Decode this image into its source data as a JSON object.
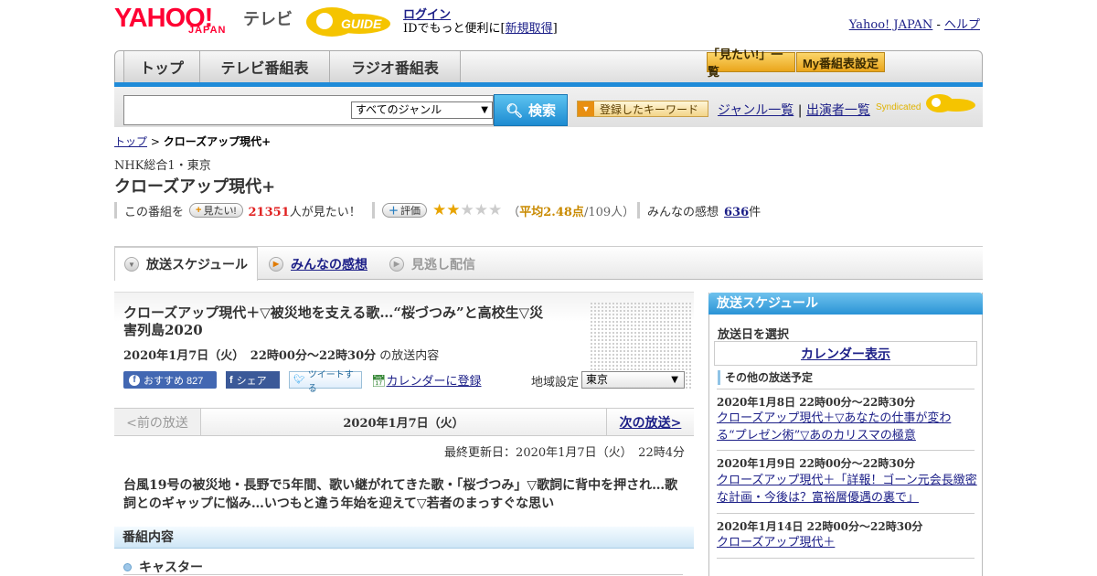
{
  "header": {
    "logo_yahoo": "YAHOO!",
    "logo_japan": "JAPAN",
    "logo_tv": "テレビ",
    "logo_gguide": "G-GUIDE",
    "login": "ログイン",
    "login_sub_prefix": "IDでもっと便利に[",
    "login_sub_link": "新規取得",
    "login_sub_suffix": "]",
    "yahoo_japan_link": "Yahoo! JAPAN",
    "sep": " - ",
    "help_link": "ヘルプ"
  },
  "nav": {
    "tabs": [
      "トップ",
      "テレビ番組表",
      "ラジオ番組表"
    ],
    "mitai_list": "「見たい!」一覧",
    "my_schedule": "My番組表設定"
  },
  "search": {
    "genre_value": "すべてのジャンル",
    "search_button": "検索",
    "keyword_button": "登録したキーワード",
    "genre_list": "ジャンル一覧",
    "divider": "|",
    "cast_list": "出演者一覧",
    "syndicated": "Syndicated"
  },
  "breadcrumb": {
    "top": "トップ",
    "sep": ">",
    "current": "クローズアップ現代+"
  },
  "program": {
    "station": "NHK総合1・東京",
    "title": "クローズアップ現代+",
    "mitai_prefix": "この番組を",
    "mitai_button": "見たい!",
    "mitai_count": "21351",
    "mitai_suffix": "人が見たい！",
    "rating_button": "評価",
    "rating_value": 2,
    "rating_max": 5,
    "rating_avg_prefix": "（",
    "rating_avg": "平均2.48点",
    "rating_people": "/109人）",
    "impressions_prefix": "みんなの感想",
    "impressions_count": "636",
    "impressions_suffix": "件"
  },
  "tabs": {
    "schedule": "放送スケジュール",
    "impressions": "みんなの感想",
    "missed": "見逃し配信"
  },
  "episode": {
    "title": "クローズアップ現代＋▽被災地を支える歌…“桜づつみ”と高校生▽災害列島2020",
    "date": "2020年1月7日（火）　22時00分～22時30分",
    "date_suffix": "の放送内容",
    "fb_recommend": "おすすめ 827",
    "fb_share": "シェア",
    "tweet": "ツイートする",
    "calendar_register": "カレンダーに登録",
    "region_label": "地域設定",
    "region_value": "東京",
    "prev": "<前の放送",
    "current_date": "2020年1月7日（火）",
    "next": "次の放送>",
    "updated": "最終更新日：2020年1月7日（火）　22時4分",
    "description": "台風19号の被災地・長野で5年間、歌い継がれてきた歌・「桜づつみ」▽歌詞に背中を押され…歌詞とのギャップに悩み…いつもと違う年始を迎えて▽若者のまっすぐな思い",
    "section_head": "番組内容",
    "caster": "キャスター"
  },
  "sidebar": {
    "head": "放送スケジュール",
    "pick_day": "放送日を選択",
    "calendar": "カレンダー表示",
    "other_head": "その他の放送予定",
    "items": [
      {
        "date": "2020年1月8日  22時00分～22時30分",
        "title": "クローズアップ現代＋▽あなたの仕事が変わる“プレゼン術”▽あのカリスマの極意"
      },
      {
        "date": "2020年1月9日  22時00分～22時30分",
        "title": "クローズアップ現代＋「詳報！ゴーン元会長緻密な計画・今後は？富裕層優遇の裏で」"
      },
      {
        "date": "2020年1月14日  22時00分～22時30分",
        "title": "クローズアップ現代＋"
      }
    ]
  },
  "colors": {
    "accent_blue": "#1f8bd8",
    "brand_red": "#ff0033",
    "rating_orange": "#e8a400",
    "link": "#1d2088"
  }
}
